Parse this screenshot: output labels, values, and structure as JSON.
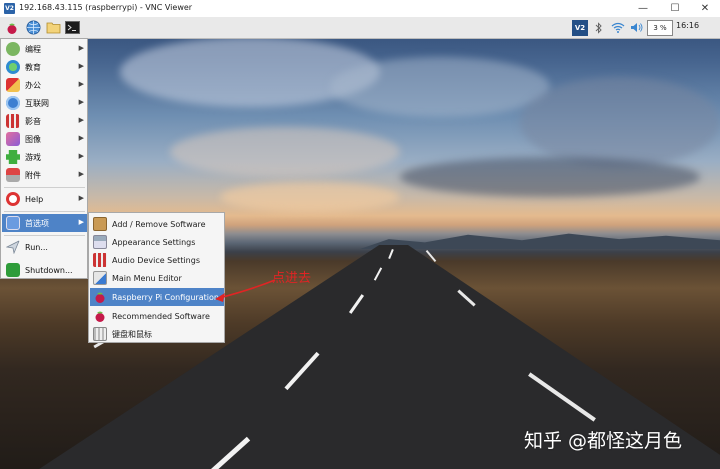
{
  "window": {
    "logo_text": "V2",
    "title": "192.168.43.115 (raspberrypi) - VNC Viewer",
    "controls": {
      "minimize": "—",
      "maximize": "☐",
      "close": "✕"
    }
  },
  "taskbar": {
    "launchers": [
      "raspberry-icon",
      "web-browser-icon",
      "file-manager-icon",
      "terminal-icon"
    ],
    "tray": {
      "vnc_logo": "V2",
      "cpu": "3 %",
      "clock": "16:16"
    }
  },
  "main_menu": {
    "items": [
      {
        "label": "编程",
        "icon": "programming-icon",
        "has_submenu": true
      },
      {
        "label": "教育",
        "icon": "education-icon",
        "has_submenu": true
      },
      {
        "label": "办公",
        "icon": "office-icon",
        "has_submenu": true
      },
      {
        "label": "互联网",
        "icon": "internet-icon",
        "has_submenu": true
      },
      {
        "label": "影音",
        "icon": "sound-video-icon",
        "has_submenu": true
      },
      {
        "label": "图像",
        "icon": "graphics-icon",
        "has_submenu": true
      },
      {
        "label": "游戏",
        "icon": "games-icon",
        "has_submenu": true
      },
      {
        "label": "附件",
        "icon": "accessories-icon",
        "has_submenu": true
      },
      {
        "label": "Help",
        "icon": "help-icon",
        "has_submenu": true
      },
      {
        "label": "首选项",
        "icon": "preferences-icon",
        "has_submenu": true
      },
      {
        "label": "Run...",
        "icon": "run-icon",
        "has_submenu": false
      },
      {
        "label": "Shutdown...",
        "icon": "shutdown-icon",
        "has_submenu": false
      }
    ],
    "active_item": "首选项"
  },
  "submenu": {
    "items": [
      {
        "label": "Add / Remove Software",
        "icon": "package-icon"
      },
      {
        "label": "Appearance Settings",
        "icon": "appearance-icon"
      },
      {
        "label": "Audio Device Settings",
        "icon": "audio-icon"
      },
      {
        "label": "Main Menu Editor",
        "icon": "menu-editor-icon"
      },
      {
        "label": "Raspberry Pi Configuration",
        "icon": "raspberry-icon"
      },
      {
        "label": "Recommended Software",
        "icon": "raspberry-icon"
      },
      {
        "label": "键盘和鼠标",
        "icon": "keyboard-mouse-icon"
      }
    ],
    "active_item": "Raspberry Pi Configuration"
  },
  "annotation": {
    "text": "点进去",
    "color": "#e02424"
  },
  "watermark": {
    "text": "知乎 @都怪这月色"
  },
  "colors": {
    "menu_highlight": "#4e83c7",
    "menu_bg": "#f5f5f5",
    "taskbar_bg": "#e9e9e9"
  }
}
